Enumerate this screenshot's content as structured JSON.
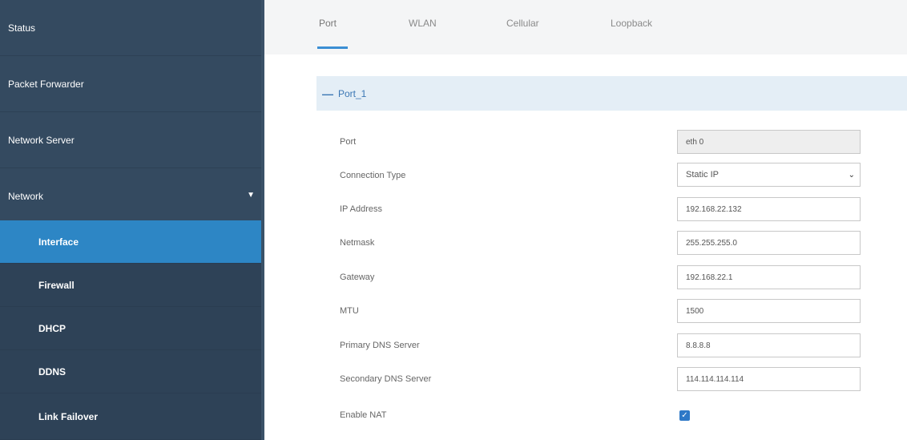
{
  "sidebar": {
    "items": [
      {
        "label": "Status"
      },
      {
        "label": "Packet Forwarder"
      },
      {
        "label": "Network Server"
      },
      {
        "label": "Network"
      }
    ],
    "network_arrow_icon": "triangle-down-icon",
    "submenu": [
      {
        "label": "Interface",
        "active": true
      },
      {
        "label": "Firewall"
      },
      {
        "label": "DHCP"
      },
      {
        "label": "DDNS"
      },
      {
        "label": "Link Failover"
      }
    ]
  },
  "tabs": [
    {
      "label": "Port",
      "active": true
    },
    {
      "label": "WLAN"
    },
    {
      "label": "Cellular"
    },
    {
      "label": "Loopback"
    }
  ],
  "section": {
    "collapse_symbol": "—",
    "title": "Port_1"
  },
  "form": {
    "port": {
      "label": "Port",
      "value": "eth 0"
    },
    "connection_type": {
      "label": "Connection Type",
      "value": "Static IP"
    },
    "ip_address": {
      "label": "IP Address",
      "value": "192.168.22.132"
    },
    "netmask": {
      "label": "Netmask",
      "value": "255.255.255.0"
    },
    "gateway": {
      "label": "Gateway",
      "value": "192.168.22.1"
    },
    "mtu": {
      "label": "MTU",
      "value": "1500"
    },
    "primary_dns": {
      "label": "Primary DNS Server",
      "value": "8.8.8.8"
    },
    "secondary_dns": {
      "label": "Secondary DNS Server",
      "value": "114.114.114.114"
    },
    "enable_nat": {
      "label": "Enable NAT",
      "checked": true
    }
  },
  "colors": {
    "sidebar_bg": "#344a60",
    "active_item": "#2d86c5",
    "accent": "#3b8ed3"
  }
}
